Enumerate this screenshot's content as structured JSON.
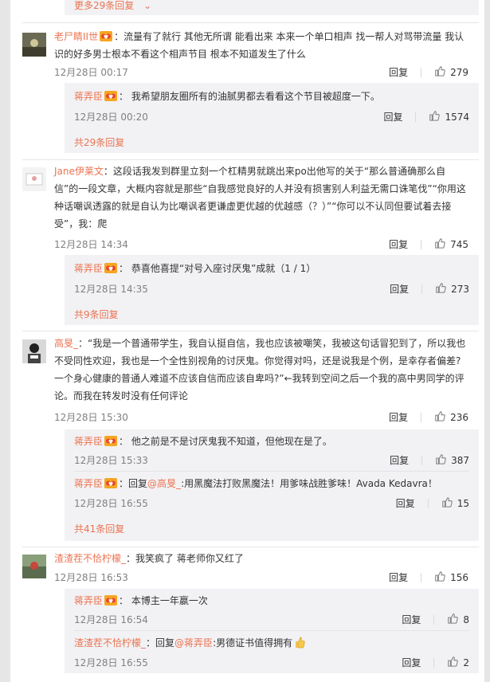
{
  "top_more": {
    "label": "更多29条回复"
  },
  "actions": {
    "reply": "回复"
  },
  "comments": [
    {
      "user": "老尸睛II世",
      "text": "流量有了就行 其他无所谓 能看出来 本来一个单口相声 找一帮人对骂带流量 我认识的好多男士根本不看这个相声节目 根本不知道发生了什么",
      "time": "12月28日 00:17",
      "likes": "279",
      "replies": [
        {
          "user": "蒋弄臣",
          "text": "我希望朋友圈所有的油腻男都去看看这个节目被超度一下。",
          "time": "12月28日 00:20",
          "likes": "1574"
        }
      ],
      "more": "共29条回复"
    },
    {
      "user": "Jane伊莱文",
      "text": "这段话我发到群里立刻一个杠精男就跳出来po出他写的关于“那么普通确那么自信”的一段文章，大概内容就是那些“自我感觉良好的人并没有损害别人利益无需口诛笔伐”“你用这种话嘲讽透露的就是自认为比嘲讽者更谦虚更优越的优越感（？）”“你可以不认同但要试着去接受”，我：爬",
      "time": "12月28日 14:34",
      "likes": "745",
      "replies": [
        {
          "user": "蒋弄臣",
          "text": "恭喜他喜提“对号入座讨厌鬼”成就（1 / 1）",
          "time": "12月28日 14:35",
          "likes": "273"
        }
      ],
      "more": "共9条回复"
    },
    {
      "user": "高旻_",
      "text": "“我是一个普通带学生，我自认挺自信，我也应该被嘲笑，我被这句话冒犯到了，所以我也不受同性欢迎，我也是一个全性别视角的讨厌鬼。你觉得对吗，还是说我是个例，是幸存者偏差?一个身心健康的普通人难道不应该自信而应该自卑吗?”←我转到空间之后一个我的高中男同学的评论。而我在转发时没有任何评论",
      "time": "12月28日 15:30",
      "likes": "236",
      "replies": [
        {
          "user": "蒋弄臣",
          "text": "他之前是不是讨厌鬼我不知道，但他现在是了。",
          "time": "12月28日 15:33",
          "likes": "387"
        },
        {
          "user": "蒋弄臣",
          "reply_prefix": "回复",
          "mention": "@高旻_",
          "text": ":用黑魔法打败黑魔法！用爹味战胜爹味！Avada Kedavra！",
          "time": "12月28日 16:55",
          "likes": "15"
        }
      ],
      "more": "共41条回复"
    },
    {
      "user": "渣渣茬不恰柠檬_",
      "text": "我笑疯了 蒋老师你又红了",
      "time": "12月28日 16:53",
      "likes": "156",
      "replies": [
        {
          "user": "蒋弄臣",
          "text": "本博主一年嬴一次",
          "time": "12月28日 16:54",
          "likes": "8"
        },
        {
          "user": "渣渣茬不恰柠檬_",
          "reply_prefix": "回复",
          "mention": "@蒋弄臣",
          "text": ":男德证书值得拥有",
          "time": "12月28日 16:55",
          "likes": "2"
        }
      ]
    }
  ]
}
